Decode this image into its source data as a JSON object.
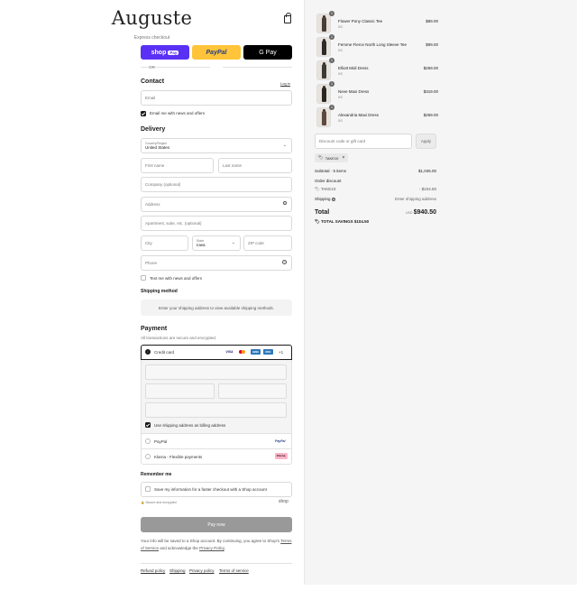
{
  "brand": {
    "name": "Auguste"
  },
  "express": {
    "title": "Express checkout",
    "shop_label": "shop",
    "shop_pay_label": "Pay",
    "paypal_label": "PayPal",
    "gpay_label": "G Pay",
    "or_label": "OR"
  },
  "contact": {
    "title": "Contact",
    "login_link": "Log in",
    "email_placeholder": "Email",
    "news_label": "Email me with news and offers"
  },
  "delivery": {
    "title": "Delivery",
    "country_label": "Country/Region",
    "country_value": "United States",
    "first_name": "First name",
    "last_name": "Last name",
    "company": "Company (optional)",
    "address": "Address",
    "apartment": "Apartment, suite, etc. (optional)",
    "city": "City",
    "state_label": "State",
    "state_value": "Iowa",
    "zip": "ZIP code",
    "phone": "Phone",
    "text_news_label": "Text me with news and offers"
  },
  "shipping": {
    "title": "Shipping method",
    "placeholder": "Enter your shipping address to view available shipping methods."
  },
  "payment": {
    "title": "Payment",
    "subtitle": "All transactions are secure and encrypted.",
    "credit_card_label": "Credit card",
    "card_logos": [
      "VISA",
      "MC",
      "AMEX",
      "DISC"
    ],
    "more_cards": "+1",
    "billing_label": "Use shipping address as billing address",
    "paypal_label": "PayPal",
    "paypal_badge": "PayPal",
    "klarna_label": "Klarna - Flexible payments",
    "klarna_badge": "Klarna."
  },
  "remember": {
    "title": "Remember me",
    "save_label": "Save my information for a faster checkout with a Shop account",
    "secure_label": "Secure and encrypted",
    "shop_logo": "shop"
  },
  "pay_button": "Pay now",
  "disclaimer": {
    "text": "Your info will be saved to a Shop account. By continuing, you agree to Shop's",
    "terms": "Terms of Service",
    "and": "and acknowledge the",
    "privacy": "Privacy Policy",
    "end": "."
  },
  "footer_links": [
    "Refund policy",
    "Shipping",
    "Privacy policy",
    "Terms of service"
  ],
  "cart": {
    "items": [
      {
        "qty": "1",
        "name": "Flower Pony Classic Tee",
        "size": "XS",
        "price": "$89.00"
      },
      {
        "qty": "1",
        "name": "Femme Fierce North Long Sleeve Tee",
        "size": "XS",
        "price": "$99.00"
      },
      {
        "qty": "1",
        "name": "Elliott Midi Dress",
        "size": "XS",
        "price": "$269.00"
      },
      {
        "qty": "1",
        "name": "Neve Maxi Dress",
        "size": "XS",
        "price": "$319.00"
      },
      {
        "qty": "1",
        "name": "Alexandria Maxi Dress",
        "size": "XS",
        "price": "$269.00"
      }
    ],
    "discount_placeholder": "Discount code or gift card",
    "apply_label": "Apply",
    "applied_code": "TAKE10",
    "subtotal_label": "Subtotal · 5 items",
    "subtotal_value": "$1,045.00",
    "order_discount_label": "Order discount",
    "discount_code": "TAKE10",
    "discount_value": "- $104.50",
    "shipping_label": "Shipping",
    "shipping_value": "Enter shipping address",
    "total_label": "Total",
    "currency": "USD",
    "total_value": "$940.50",
    "savings_label": "TOTAL SAVINGS",
    "savings_value": "$104.50"
  },
  "colors": {
    "shop_pay": "#5a31f4",
    "paypal": "#ffc439",
    "gpay": "#000000",
    "pay_now_disabled": "#999999"
  }
}
